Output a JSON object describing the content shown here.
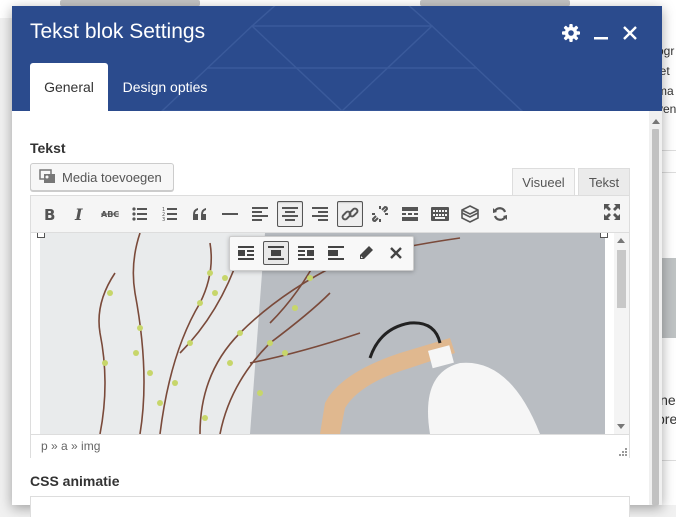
{
  "modal": {
    "title": "Tekst blok Settings",
    "tabs": [
      {
        "label": "General",
        "active": true
      },
      {
        "label": "Design opties",
        "active": false
      }
    ],
    "header_color": "#2b4b8d"
  },
  "fields": {
    "tekst_label": "Tekst",
    "css_animatie_label": "CSS animatie"
  },
  "editor": {
    "media_button_label": "Media toevoegen",
    "mode_tabs": {
      "visual": "Visueel",
      "text": "Tekst"
    },
    "toolbar_buttons": [
      "bold-icon",
      "italic-icon",
      "strikethrough-icon",
      "bullet-list-icon",
      "numbered-list-icon",
      "blockquote-icon",
      "horizontal-rule-icon",
      "align-left-icon",
      "align-center-icon",
      "align-right-icon",
      "link-icon",
      "unlink-icon",
      "read-more-icon",
      "toolbar-toggle-icon",
      "layers-icon",
      "refresh-icon",
      "fullscreen-icon"
    ],
    "image_toolbar_buttons": [
      "image-align-left-icon",
      "image-align-center-icon",
      "image-align-right-icon",
      "image-align-none-icon",
      "edit-icon",
      "remove-icon"
    ],
    "status_path": "p » a » img"
  },
  "background_page": {
    "right_snippets": [
      "ogr",
      "iet",
      "ma",
      "ven",
      ".",
      "ine",
      "pre"
    ]
  }
}
